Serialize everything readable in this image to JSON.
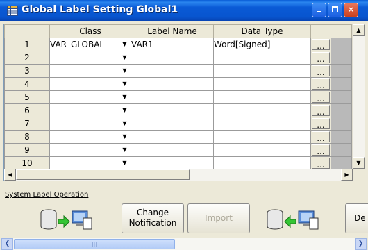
{
  "window": {
    "title": "Global Label Setting Global1",
    "controls": {
      "minimize": "_",
      "maximize": "□",
      "close": "X"
    }
  },
  "grid": {
    "columns": [
      "Class",
      "Label Name",
      "Data Type"
    ],
    "rows": [
      {
        "num": "1",
        "class": "VAR_GLOBAL",
        "label": "VAR1",
        "type": "Word[Signed]"
      },
      {
        "num": "2",
        "class": "",
        "label": "",
        "type": ""
      },
      {
        "num": "3",
        "class": "",
        "label": "",
        "type": ""
      },
      {
        "num": "4",
        "class": "",
        "label": "",
        "type": ""
      },
      {
        "num": "5",
        "class": "",
        "label": "",
        "type": ""
      },
      {
        "num": "6",
        "class": "",
        "label": "",
        "type": ""
      },
      {
        "num": "7",
        "class": "",
        "label": "",
        "type": ""
      },
      {
        "num": "8",
        "class": "",
        "label": "",
        "type": ""
      },
      {
        "num": "9",
        "class": "",
        "label": "",
        "type": ""
      },
      {
        "num": "10",
        "class": "",
        "label": "",
        "type": ""
      }
    ],
    "ellipsis": "..."
  },
  "operation": {
    "section_label": "System Label Operation",
    "change_notification": {
      "line1": "Change",
      "line2": "Notification"
    },
    "import": "Import",
    "cut_label": "De"
  },
  "scroll": {
    "thumb_grip": "|||"
  },
  "colors": {
    "titlebar": "#0a5ad6",
    "face": "#ece9d8",
    "close": "#c8401f"
  }
}
